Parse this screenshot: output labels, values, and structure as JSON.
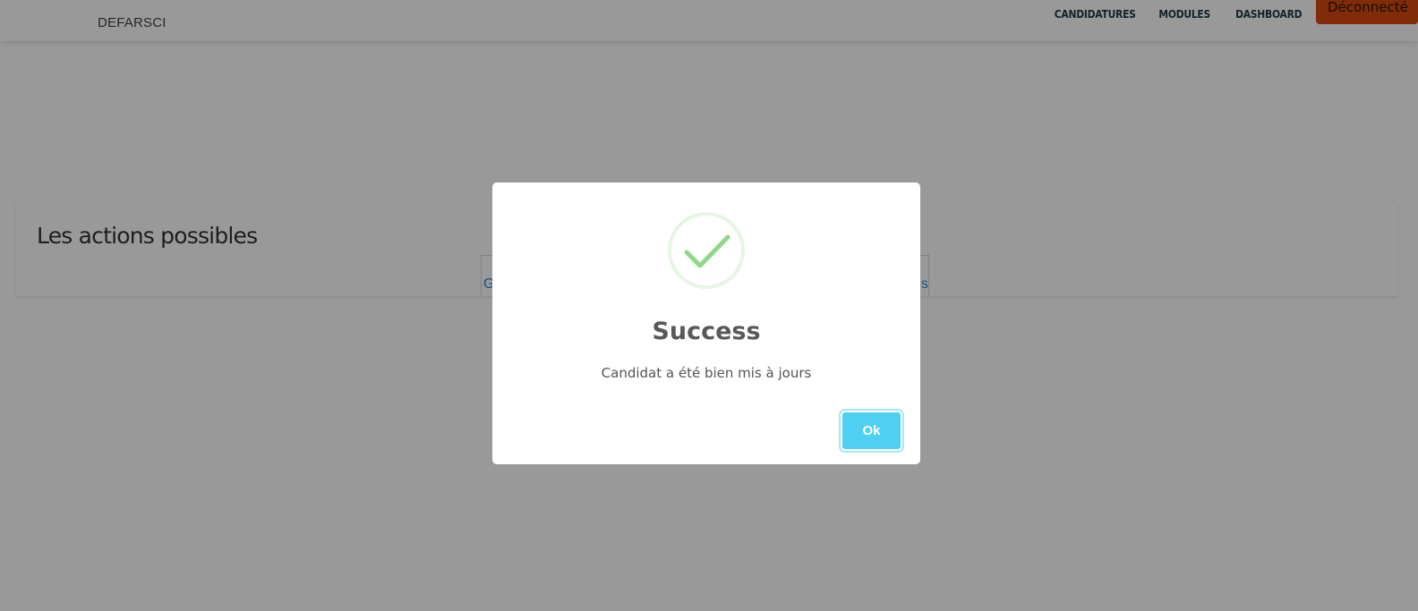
{
  "navbar": {
    "brand": "DEFARSCI",
    "links": [
      "CANDIDATURES",
      "MODULES",
      "DASHBOARD"
    ],
    "logout_label": "Déconnecté"
  },
  "actions": {
    "title": "Les actions possibles",
    "link_left_partial": "G",
    "link_right_partial": "es"
  },
  "modal": {
    "icon": "checkmark-success-icon",
    "title": "Success",
    "message": "Candidat a été bien mis à jours",
    "ok_label": "Ok"
  },
  "colors": {
    "overlay": "#000000",
    "ok_button": "#4dd0f3",
    "success_green": "#8fd88a",
    "logout": "#d9480f",
    "nav_text": "#1e3b47"
  }
}
